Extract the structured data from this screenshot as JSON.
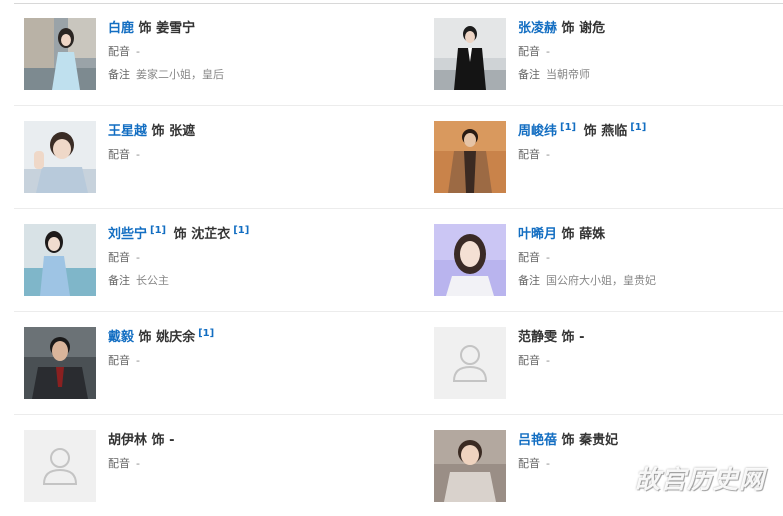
{
  "labels": {
    "as": "饰",
    "dub": "配音",
    "note": "备注",
    "dash": "-",
    "ref": "[1]"
  },
  "watermark": "故宫历史网",
  "cast": [
    {
      "actor": "白鹿",
      "actor_ref": false,
      "role": "姜雪宁",
      "role_ref": false,
      "dub": "-",
      "note": "姜家二小姐，皇后"
    },
    {
      "actor": "张凌赫",
      "actor_ref": false,
      "role": "谢危",
      "role_ref": false,
      "dub": "-",
      "note": "当朝帝师"
    },
    {
      "actor": "王星越",
      "actor_ref": false,
      "role": "张遮",
      "role_ref": false,
      "dub": "-",
      "note": null
    },
    {
      "actor": "周峻纬",
      "actor_ref": true,
      "role": "燕临",
      "role_ref": true,
      "dub": "-",
      "note": null
    },
    {
      "actor": "刘些宁",
      "actor_ref": true,
      "role": "沈芷衣",
      "role_ref": true,
      "dub": "-",
      "note": "长公主"
    },
    {
      "actor": "叶晞月",
      "actor_ref": false,
      "role": "薛姝",
      "role_ref": false,
      "dub": "-",
      "note": "国公府大小姐，皇贵妃"
    },
    {
      "actor": "戴毅",
      "actor_ref": false,
      "role": "姚庆余",
      "role_ref": true,
      "dub": "-",
      "note": null
    },
    {
      "actor": "范静雯",
      "actor_ref": false,
      "role": "-",
      "role_ref": false,
      "dub": "-",
      "note": null
    },
    {
      "actor": "胡伊林",
      "actor_ref": false,
      "role": "-",
      "role_ref": false,
      "dub": "-",
      "note": null
    },
    {
      "actor": "吕艳蓓",
      "actor_ref": false,
      "role": "秦贵妃",
      "role_ref": false,
      "dub": "-",
      "note": null
    }
  ]
}
